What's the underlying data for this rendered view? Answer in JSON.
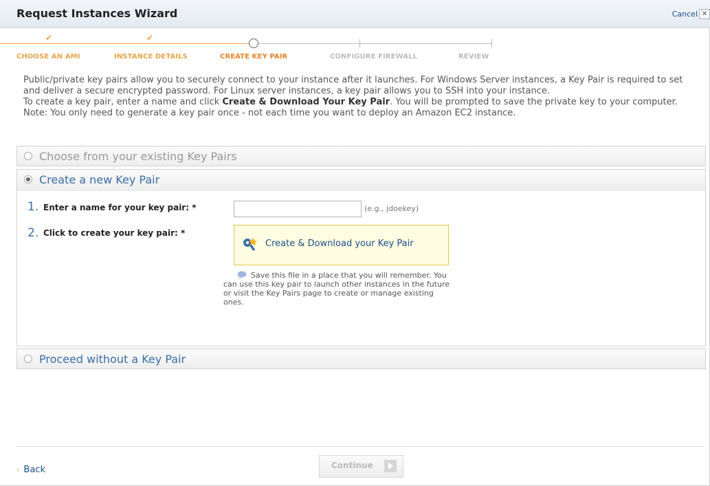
{
  "wizard": {
    "title": "Request Instances Wizard",
    "cancel_label": "Cancel"
  },
  "steps": [
    {
      "label": "CHOOSE AN AMI",
      "state": "done"
    },
    {
      "label": "INSTANCE DETAILS",
      "state": "done"
    },
    {
      "label": "CREATE KEY PAIR",
      "state": "current"
    },
    {
      "label": "CONFIGURE FIREWALL",
      "state": "todo"
    },
    {
      "label": "REVIEW",
      "state": "todo"
    }
  ],
  "description": {
    "para1": "Public/private key pairs allow you to securely connect to your instance after it launches. For Windows Server instances, a Key Pair is required to set and deliver a secure encrypted password. For Linux server instances, a key pair allows you to SSH into your instance.",
    "para2_before": "To create a key pair, enter a name and click ",
    "para2_bold": "Create & Download Your Key Pair",
    "para2_after": ". You will be prompted to save the private key to your computer. Note: You only need to generate a key pair once - not each time you want to deploy an Amazon EC2 instance."
  },
  "options": {
    "existing": {
      "label": "Choose from your existing Key Pairs",
      "selected": false
    },
    "create_new": {
      "label": "Create a new Key Pair",
      "selected": true
    },
    "proceed_without": {
      "label": "Proceed without a Key Pair",
      "selected": false
    }
  },
  "create_form": {
    "step1_num": "1.",
    "step1_label": "Enter a name for your key pair: *",
    "keyname_value": "",
    "keyname_example": "(e.g., jdoekey)",
    "step2_num": "2.",
    "step2_label": "Click to create your key pair: *",
    "create_button_label": "Create & Download your Key Pair",
    "hint": "Save this file in a place that you will remember. You can use this key pair to launch other instances in the future or visit the Key Pairs page to create or manage existing ones."
  },
  "footer": {
    "back_label": "Back",
    "continue_label": "Continue"
  },
  "colors": {
    "accent_orange": "#e8a54a",
    "link_blue": "#1a4e8c",
    "option_blue": "#3a6ea5"
  }
}
